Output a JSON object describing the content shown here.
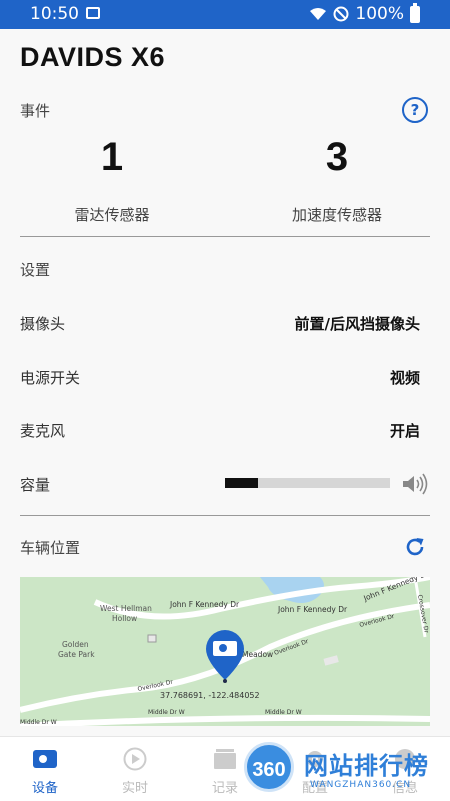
{
  "status_bar": {
    "time": "10:50",
    "battery": "100%"
  },
  "app": {
    "title": "DAVIDS X6"
  },
  "events": {
    "label": "事件",
    "radar_count": "1",
    "radar_label": "雷达传感器",
    "accel_count": "3",
    "accel_label": "加速度传感器"
  },
  "settings": {
    "label": "设置",
    "camera_label": "摄像头",
    "camera_value": "前置/后风挡摄像头",
    "power_label": "电源开关",
    "power_value": "视频",
    "mic_label": "麦克风",
    "mic_value": "开启",
    "volume_label": "容量",
    "volume_level": 0.2
  },
  "location": {
    "label": "车辆位置",
    "coords": "37.768691, -122.484052",
    "map_labels": {
      "kennedy_1": "John F Kennedy Dr",
      "kennedy_2": "John F Kennedy Dr",
      "kennedy_3": "John F Kennedy Dr",
      "west_hellman": "West Hellman",
      "hollow": "Hollow",
      "golden": "Golden",
      "gate_park": "Gate Park",
      "meadow": "Meadow",
      "overlook_1": "Overlook Dr",
      "overlook_2": "Overlook Dr",
      "overlook_3": "Overlook Dr",
      "middle_1": "Middle Dr W",
      "middle_2": "Middle Dr W",
      "middle_3": "Middle Dr W",
      "crossover": "Crossover Dr"
    }
  },
  "bottom_nav": {
    "items": [
      {
        "label": "设备"
      },
      {
        "label": "实时"
      },
      {
        "label": "记录"
      },
      {
        "label": "配置"
      },
      {
        "label": "信息"
      }
    ]
  },
  "watermark": {
    "badge": "360",
    "text": "网站排行榜",
    "sub": "WANGZHAN360.CN"
  },
  "colors": {
    "primary": "#1f64c8",
    "map_green": "#cce6c6",
    "water": "#a9d3f0"
  }
}
